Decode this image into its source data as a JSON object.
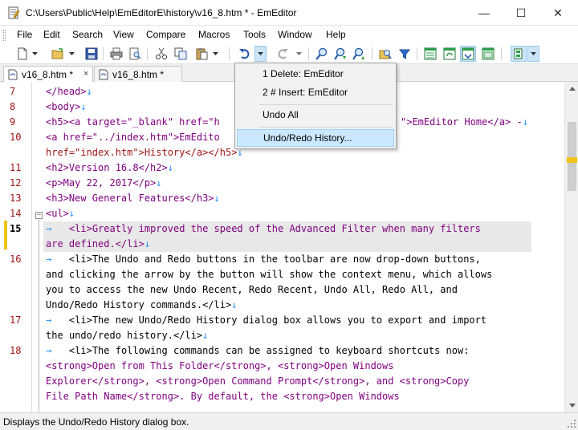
{
  "window": {
    "title": "C:\\Users\\Public\\Help\\EmEditorE\\history\\v16_8.htm * - EmEditor",
    "minimize": "—",
    "maximize": "☐",
    "close": "✕"
  },
  "menu": [
    "File",
    "Edit",
    "Search",
    "View",
    "Compare",
    "Macros",
    "Tools",
    "Window",
    "Help"
  ],
  "toolbar": {
    "buttons": [
      "new-file-icon",
      "open-folder-icon",
      "save-icon",
      "print-icon",
      "print-preview-icon",
      "cut-icon",
      "copy-icon",
      "paste-icon",
      "undo-icon",
      "redo-icon",
      "find-icon",
      "find-next-icon",
      "find-previous-icon",
      "find-in-files-icon",
      "filter-icon",
      "window-split-icon",
      "refresh-icon",
      "sync-icon",
      "outline-icon"
    ]
  },
  "tabs": [
    {
      "label": "v16_8.htm *",
      "close": "×",
      "active": true
    },
    {
      "label": "v16_8.htm *",
      "active": false
    }
  ],
  "undo_menu": {
    "items": [
      "1 Delete: EmEditor",
      "2 # Insert: EmEditor",
      "Undo All",
      "Undo/Redo History..."
    ]
  },
  "editor": {
    "line_numbers": [
      "7",
      "8",
      "9",
      "10",
      "",
      "11",
      "12",
      "13",
      "14",
      "15",
      "",
      "16",
      "",
      "",
      "",
      "17",
      "",
      "18",
      "",
      "",
      ""
    ],
    "current_line": "15",
    "fold_symbol": "⊟",
    "arrow": "→",
    "line_end": "↓",
    "lines": {
      "l7": "</head>",
      "l8": "<body>",
      "l9a": "<h5><a target=\"_blank\" href=\"h",
      "l9b": "\">EmEditor Home</a> -",
      "l10a": "<a href=\"../index.htm\">EmEdito",
      "l10b": "href=\"index.htm\">History</a></h5>",
      "l11": "<h2>Version 16.8</h2>",
      "l12": "<p>May 22, 2017</p>",
      "l13": "<h3>New General Features</h3>",
      "l14": "<ul>",
      "l15a": "<li>Greatly improved the speed of the Advanced Filter when many filters",
      "l15b": "are defined.</li>",
      "l16a": "<li>The Undo and Redo buttons in the toolbar are now drop-down buttons,",
      "l16b": "and clicking the arrow by the button will show the context menu, which allows",
      "l16c": "you to access the new Undo Recent, Redo Recent, Undo All, Redo All, and",
      "l16d": "Undo/Redo History commands.</li>",
      "l17a": "<li>The new Undo/Redo History dialog box allows you to export and import",
      "l17b": "the undo/redo history.</li>",
      "l18a": "<li>The following commands can be assigned to keyboard shortcuts now:",
      "l18b": "<strong>Open from This Folder</strong>, <strong>Open Windows",
      "l18c": "Explorer</strong>, <strong>Open Command Prompt</strong>, and <strong>Copy",
      "l18d": "File Path Name</strong>. By default, the <strong>Open Windows"
    }
  },
  "status": {
    "text": "Displays the Undo/Redo History dialog box."
  },
  "colors": {
    "tag": "#800080",
    "attribute": "#a31515",
    "value": "#0000ff",
    "marker": "#1e90ff",
    "change_mark": "#f0c419",
    "menu_highlight": "#cce8ff"
  }
}
